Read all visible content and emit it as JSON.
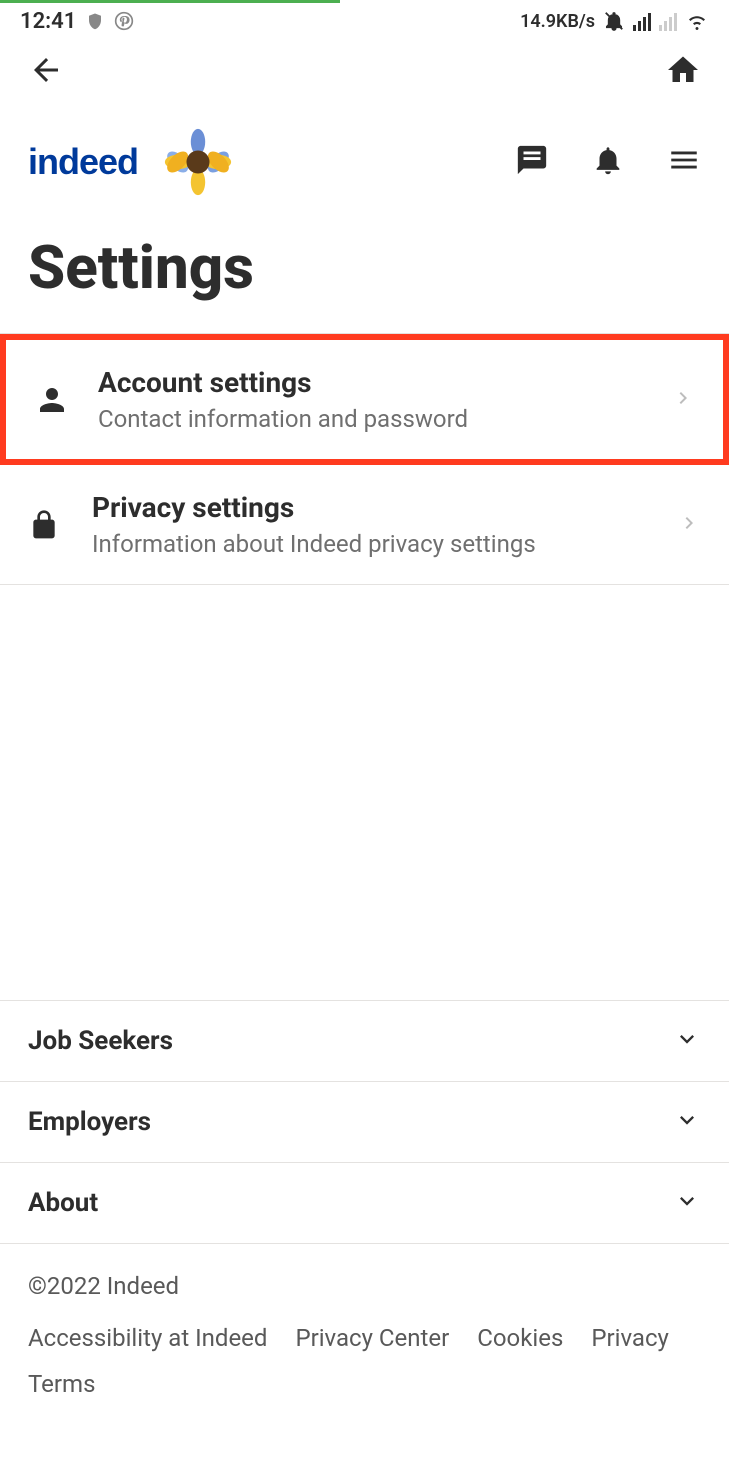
{
  "status_bar": {
    "time": "12:41",
    "data_rate": "14.9KB/s"
  },
  "brand": {
    "logo_text": "indeed"
  },
  "page": {
    "title": "Settings"
  },
  "settings": [
    {
      "icon": "person",
      "title": "Account settings",
      "subtitle": "Contact information and password",
      "highlighted": true
    },
    {
      "icon": "lock",
      "title": "Privacy settings",
      "subtitle": "Information about Indeed privacy settings",
      "highlighted": false
    }
  ],
  "footer": {
    "accordion": [
      {
        "label": "Job Seekers"
      },
      {
        "label": "Employers"
      },
      {
        "label": "About"
      }
    ],
    "copyright": "©2022 Indeed",
    "links": [
      "Accessibility at Indeed",
      "Privacy Center",
      "Cookies",
      "Privacy",
      "Terms"
    ]
  }
}
